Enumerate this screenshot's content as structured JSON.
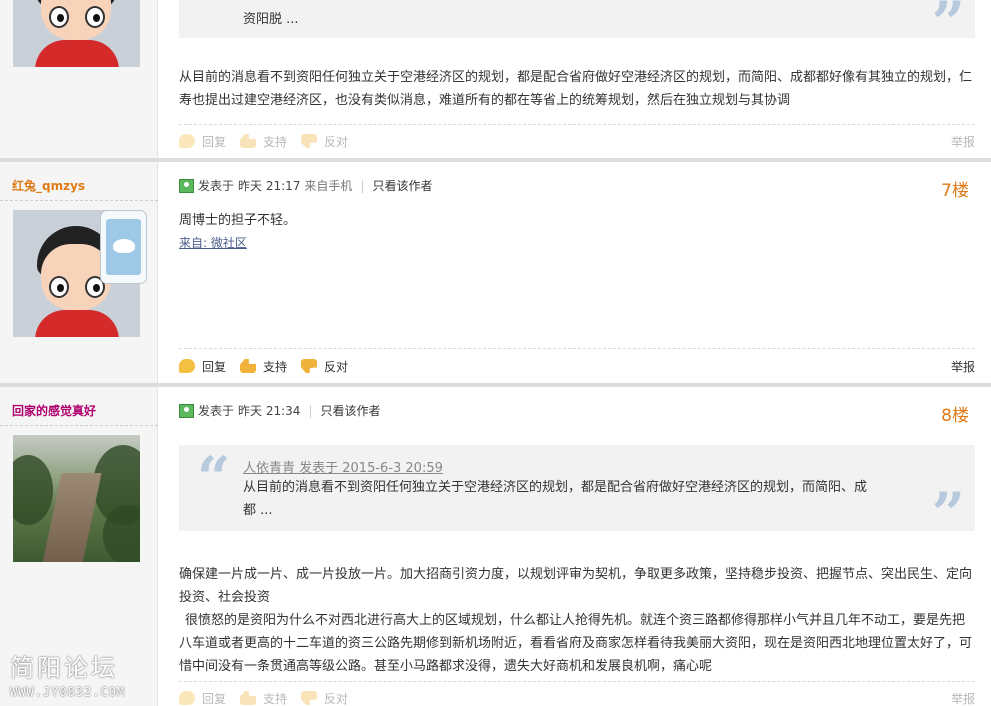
{
  "post6": {
    "quote_tail": "资阳脱 ...",
    "content": "从目前的消息看不到资阳任何独立关于空港经济区的规划，都是配合省府做好空港经济区的规划，而简阳、成都都好像有其独立的规划，仁寿也提出过建空港经济区，也没有类似消息，难道所有的都在等省上的统筹规划，然后在独立规划与其协调",
    "actions": {
      "reply": "回复",
      "support": "支持",
      "oppose": "反对",
      "report": "举报"
    }
  },
  "post7": {
    "author": "红兔_qmzys",
    "posted_label": "发表于",
    "time": "昨天 21:17",
    "from": "来自手机",
    "only_author": "只看该作者",
    "floor": "7楼",
    "content": "周博士的担子不轻。",
    "source": "来自: 微社区",
    "actions": {
      "reply": "回复",
      "support": "支持",
      "oppose": "反对",
      "report": "举报"
    }
  },
  "post8": {
    "author": "回家的感觉真好",
    "posted_label": "发表于",
    "time": "昨天 21:34",
    "only_author": "只看该作者",
    "floor": "8楼",
    "quote_author": "人依青青 发表于 2015-6-3 20:59",
    "quote_text": "从目前的消息看不到资阳任何独立关于空港经济区的规划，都是配合省府做好空港经济区的规划，而简阳、成都 ...",
    "content_p1": "确保建一片成一片、成一片投放一片。加大招商引资力度，以规划评审为契机，争取更多政策，坚持稳步投资、把握节点、突出民生、定向投资、社会投资",
    "content_p2": "很愤怒的是资阳为什么不对西北进行高大上的区域规划，什么都让人抢得先机。就连个资三路都修得那样小气并且几年不动工，要是先把八车道或者更高的十二车道的资三公路先期修到新机场附近，看看省府及商家怎样看待我美丽大资阳，现在是资阳西北地理位置太好了，可惜中间没有一条贯通高等级公路。甚至小马路都求没得，遗失大好商机和发展良机啊，痛心呢",
    "actions": {
      "reply": "回复",
      "support": "支持",
      "oppose": "反对",
      "report": "举报"
    }
  },
  "watermark": {
    "line1": "简阳论坛",
    "line2": "WWW.JY0832.COM"
  }
}
